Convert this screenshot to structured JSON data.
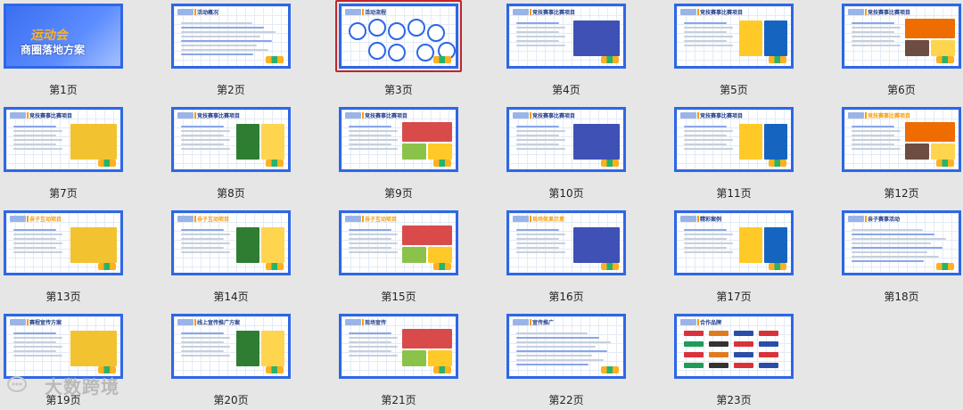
{
  "slides": [
    {
      "label": "第1页",
      "type": "cover",
      "title1": "运动会",
      "title2": "商圈落地方案"
    },
    {
      "label": "第2页",
      "type": "text",
      "title": "活动概况"
    },
    {
      "label": "第3页",
      "type": "flow",
      "title": "活动流程",
      "selected": true
    },
    {
      "label": "第4页",
      "type": "photo",
      "title": "竞技赛事比赛项目"
    },
    {
      "label": "第5页",
      "type": "photo",
      "title": "竞技赛事比赛项目"
    },
    {
      "label": "第6页",
      "type": "photo",
      "title": "竞技赛事比赛项目"
    },
    {
      "label": "第7页",
      "type": "photo",
      "title": "竞技赛事比赛项目"
    },
    {
      "label": "第8页",
      "type": "photo",
      "title": "竞技赛事比赛项目"
    },
    {
      "label": "第9页",
      "type": "photo",
      "title": "竞技赛事比赛项目"
    },
    {
      "label": "第10页",
      "type": "photo",
      "title": "竞技赛事比赛项目"
    },
    {
      "label": "第11页",
      "type": "photo",
      "title": "竞技赛事比赛项目"
    },
    {
      "label": "第12页",
      "type": "photo",
      "title": "竞技赛事比赛项目"
    },
    {
      "label": "第13页",
      "type": "photo",
      "title": "亲子互动项目"
    },
    {
      "label": "第14页",
      "type": "photo",
      "title": "亲子互动项目"
    },
    {
      "label": "第15页",
      "type": "photo",
      "title": "亲子互动项目"
    },
    {
      "label": "第16页",
      "type": "photo",
      "title": "现场效果示意"
    },
    {
      "label": "第17页",
      "type": "photo",
      "title": "精彩案例"
    },
    {
      "label": "第18页",
      "type": "text",
      "title": "亲子赛事活动"
    },
    {
      "label": "第19页",
      "type": "photo",
      "title": "赛程宣传方案"
    },
    {
      "label": "第20页",
      "type": "photo",
      "title": "线上宣传推广方案"
    },
    {
      "label": "第21页",
      "type": "photo",
      "title": "现场宣传"
    },
    {
      "label": "第22页",
      "type": "text",
      "title": "宣传推广"
    },
    {
      "label": "第23页",
      "type": "logos",
      "title": "合作品牌"
    }
  ],
  "watermark": "大数跨境",
  "colors": {
    "border": "#2e67e6",
    "selected": "#c0262c",
    "accent": "#f59e0b",
    "bg": "#e6e6e6"
  }
}
